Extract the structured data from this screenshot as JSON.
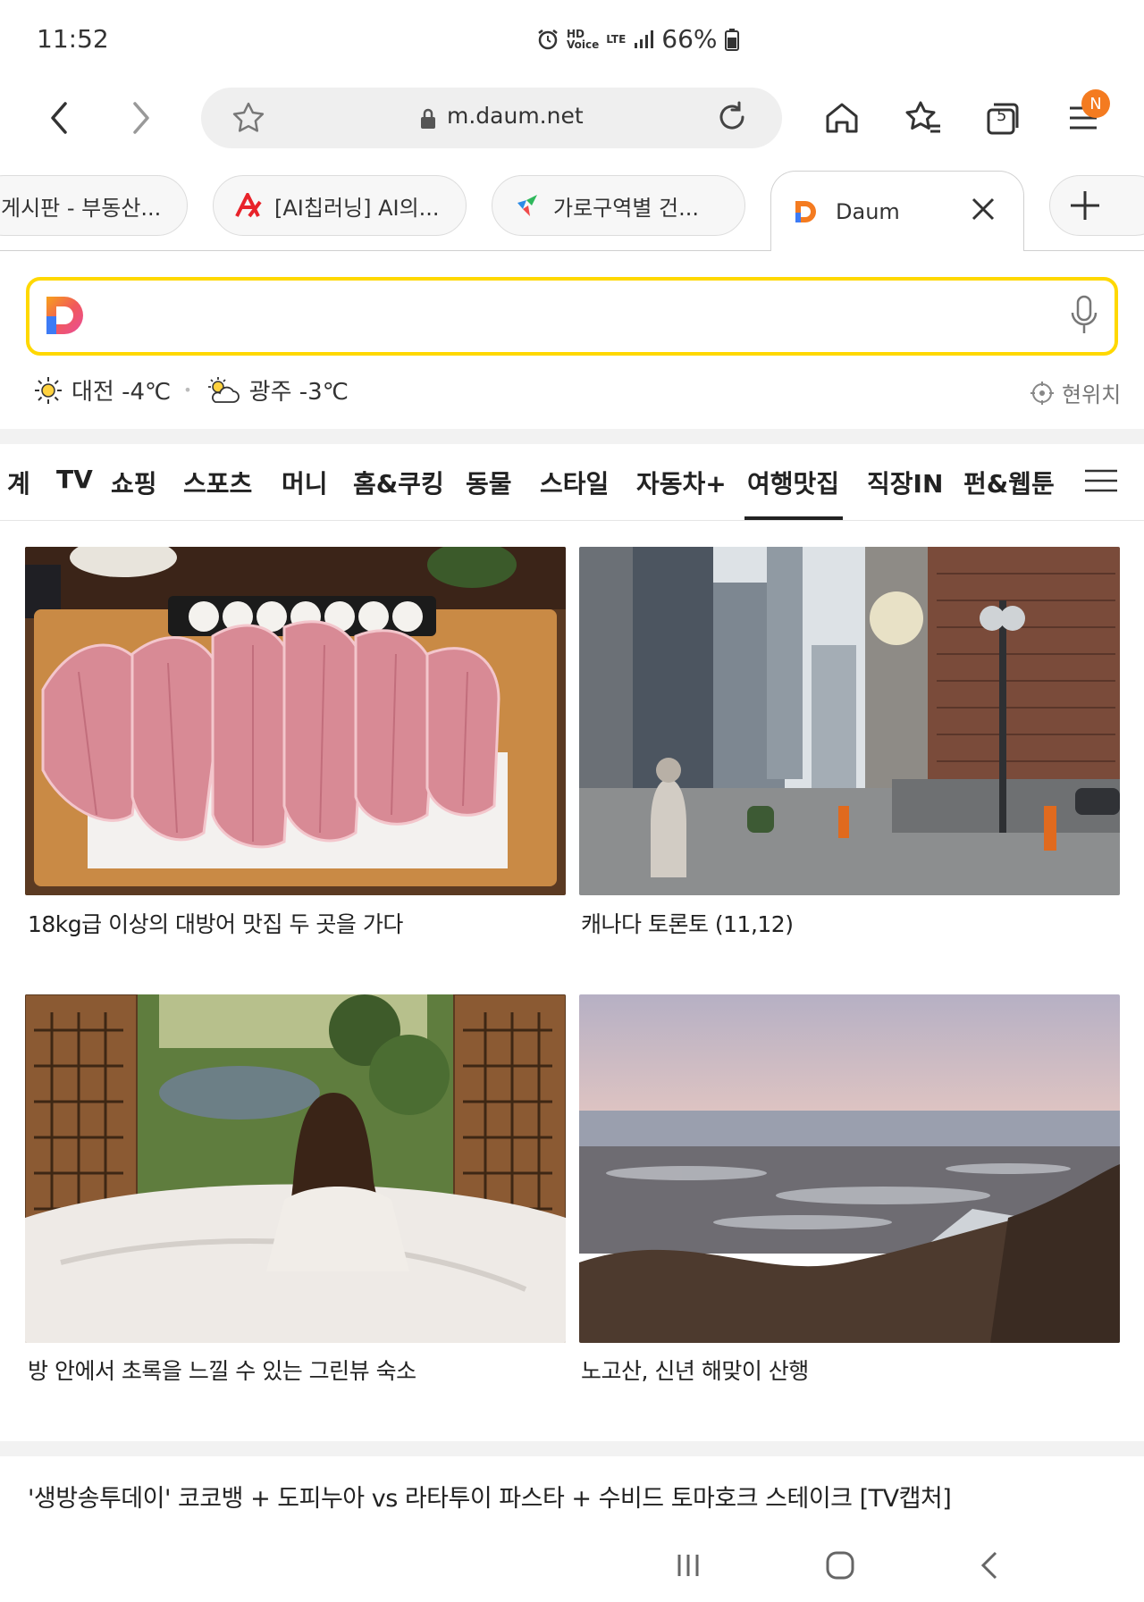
{
  "status_bar": {
    "time": "11:52",
    "hd_voice_label": "HD\nVoice",
    "lte_label": "LTE",
    "battery": "66%"
  },
  "browser": {
    "url": "m.daum.net",
    "notification_badge": "N",
    "tab_count": "5",
    "tabs": [
      {
        "label": "게시판 - 부동산..."
      },
      {
        "label": "[AI칩러닝] AI의..."
      },
      {
        "label": "가로구역별 건..."
      },
      {
        "label": "Daum"
      }
    ]
  },
  "weather": {
    "items": [
      {
        "city_temp": "대전 -4℃",
        "icon": "sun-icon"
      },
      {
        "city_temp": "광주 -3℃",
        "icon": "partly-cloudy-icon"
      }
    ],
    "location_label": "현위치"
  },
  "categories": {
    "items": [
      "계",
      "TV",
      "쇼핑",
      "스포츠",
      "머니",
      "홈&쿠킹",
      "동물",
      "스타일",
      "자동차+",
      "여행맛집",
      "직장IN",
      "펀&웹툰"
    ],
    "active": "여행맛집"
  },
  "cards": [
    {
      "title": "18kg급 이상의 대방어 맛집 두 곳을 가다"
    },
    {
      "title": "캐나다 토론토 (11,12)"
    },
    {
      "title": "방 안에서 초록을 느낄 수 있는 그린뷰 숙소"
    },
    {
      "title": "노고산, 신년 해맞이 산행"
    }
  ],
  "article": {
    "title": "'생방송투데이' 코코뱅 + 도피누아 vs 라타투이 파스타 + 수비드 토마호크 스테이크 [TV캡처]"
  },
  "colors": {
    "search_border": "#ffd800",
    "badge": "#f47b20",
    "brand_d_orange": "#f47b20",
    "brand_d_blue": "#3d7bf5"
  }
}
